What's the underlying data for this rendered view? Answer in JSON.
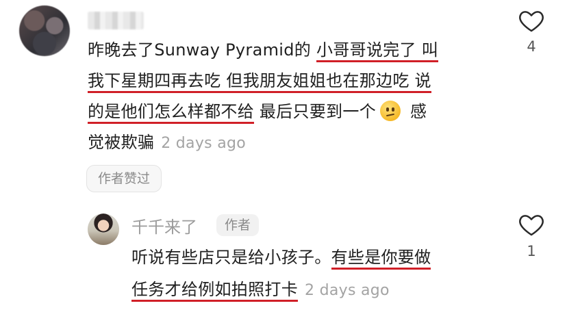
{
  "comment": {
    "username": "",
    "text_parts": {
      "p1": "昨晚去了Sunway Pyramid的 ",
      "p2": "小哥哥说完了 叫",
      "p3": "我下星期四再去吃 但我朋友姐姐也在那边吃 说",
      "p4": "的是他们怎么样都不给",
      "p5": " 最后只要到一个",
      "p6": " 感",
      "p7": "觉被欺骗"
    },
    "emoji": "confused-face-emoji",
    "time": "2 days ago",
    "author_liked_badge": "作者赞过",
    "like_count": "4"
  },
  "reply": {
    "username": "千千来了",
    "author_tag": "作者",
    "text_parts": {
      "p1": "听说有些店只是给小孩子。",
      "p2": "有些是你要做",
      "p3": "任务才给例如拍照打卡"
    },
    "time": "2 days ago",
    "like_count": "1"
  },
  "colors": {
    "underline": "#d01f27",
    "muted": "#a3a3a3"
  }
}
